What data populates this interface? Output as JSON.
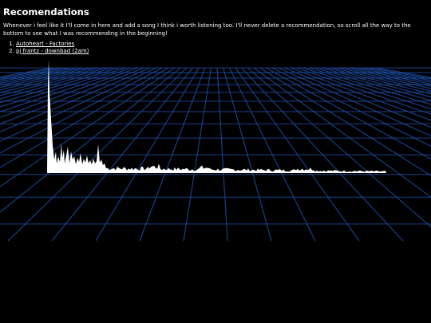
{
  "page": {
    "title": "Recomendations",
    "description": "Whenever i feel like it I'll come in here and add a song I think i worth listening too. I'll never delete a recommendation, so scroll all the way to the bottom to see what I was recommending in the beginning!"
  },
  "recommendations": [
    {
      "label": "Autoheart - Factories"
    },
    {
      "label": "pj frantz - downbad (2am)"
    }
  ],
  "colors": {
    "background": "#000000",
    "text": "#ffffff",
    "grid_line": "#1f4fa8",
    "waveform": "#ffffff"
  }
}
